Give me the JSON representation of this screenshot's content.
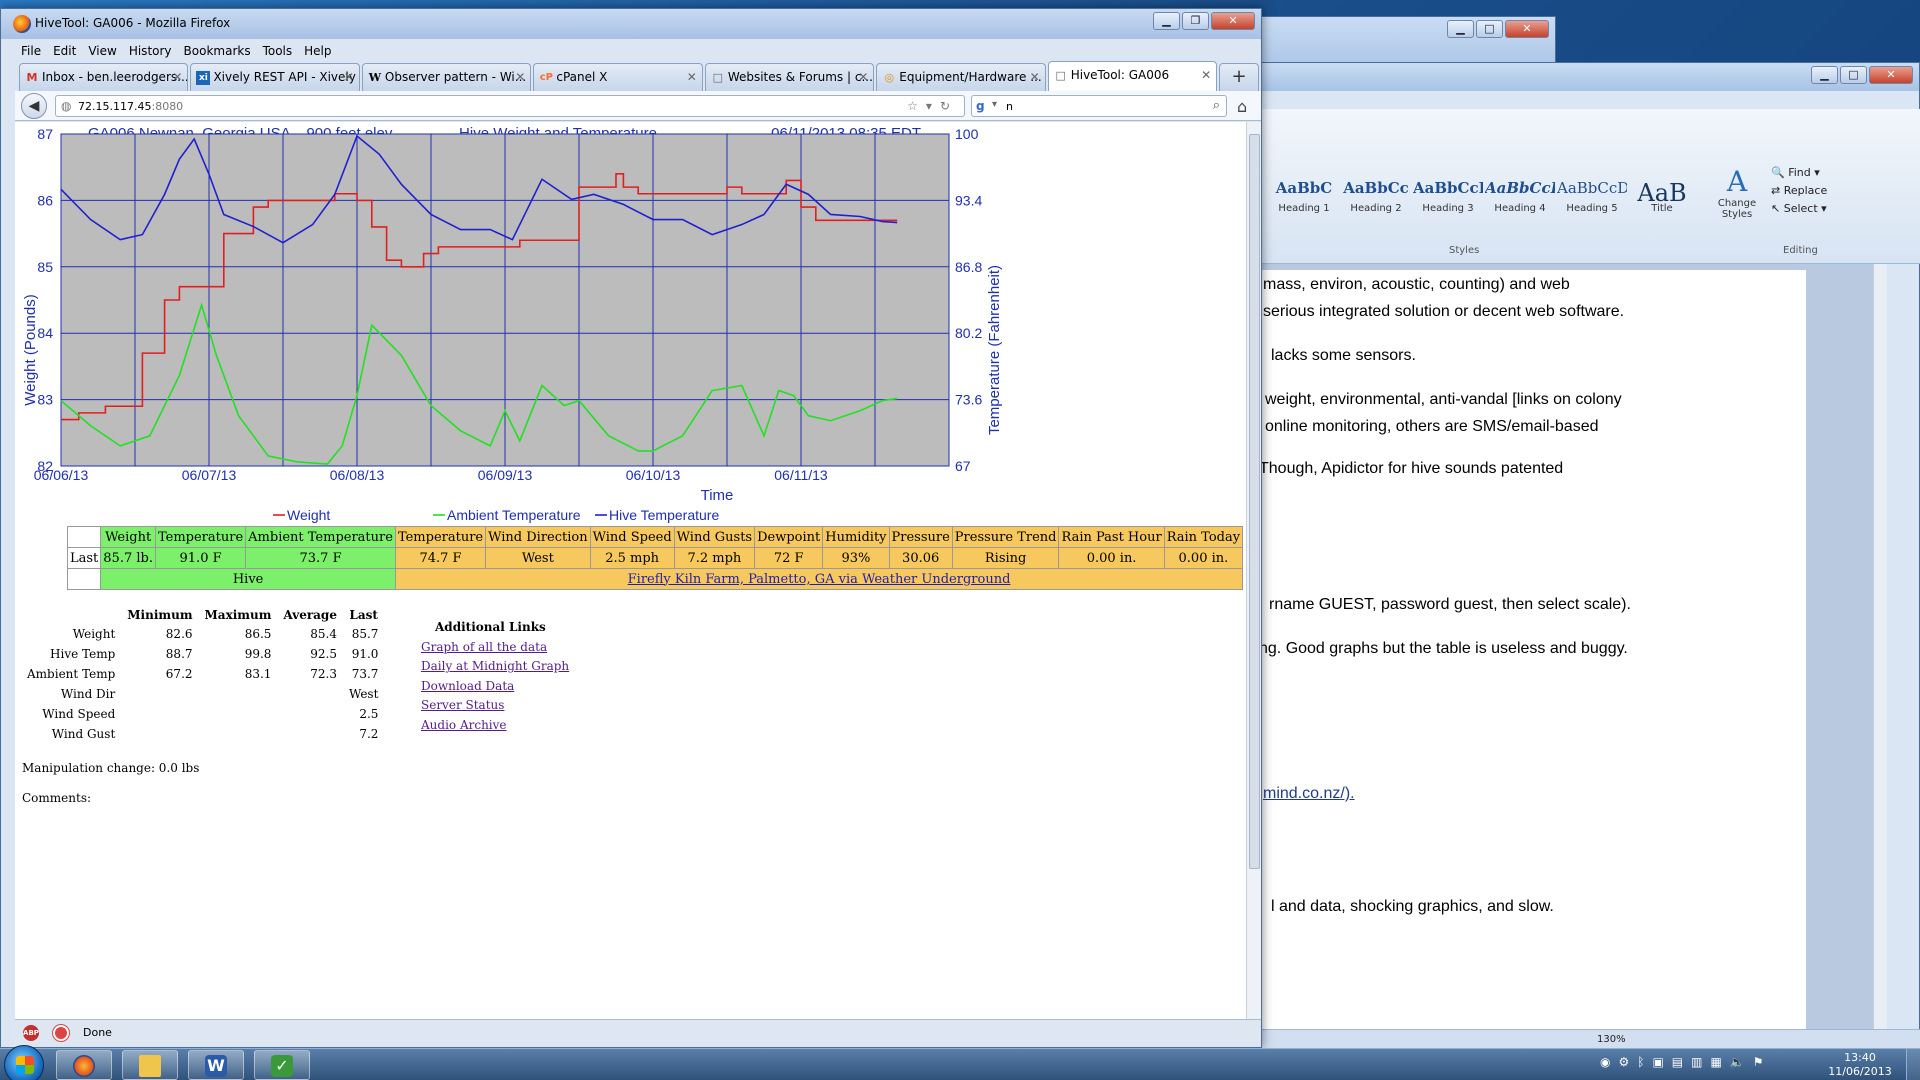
{
  "firefox": {
    "title": "HiveTool: GA006 - Mozilla Firefox",
    "menu": [
      "File",
      "Edit",
      "View",
      "History",
      "Bookmarks",
      "Tools",
      "Help"
    ],
    "tabs": [
      {
        "icon": "gmail-icon",
        "glyph": "M",
        "color": "#d93025",
        "label": "Inbox - ben.leerodgers..."
      },
      {
        "icon": "xively-icon",
        "glyph": "xi",
        "color": "#1a66b8",
        "label": "Xively REST API - Xively"
      },
      {
        "icon": "wikipedia-icon",
        "glyph": "W",
        "color": "#222222",
        "label": "Observer pattern - Wi..."
      },
      {
        "icon": "cpanel-icon",
        "glyph": "cP",
        "color": "#ff6c2c",
        "label": "cPanel X"
      },
      {
        "icon": "page-icon",
        "glyph": "□",
        "color": "#666666",
        "label": "Websites & Forums | c..."
      },
      {
        "icon": "forum-icon",
        "glyph": "◎",
        "color": "#e38a12",
        "label": "Equipment/Hardware ..."
      },
      {
        "icon": "page-icon",
        "glyph": "□",
        "color": "#666666",
        "label": "HiveTool: GA006"
      }
    ],
    "url_host": "72.15.117.45",
    "url_port": ":8080",
    "search_text": "n",
    "status": "Done"
  },
  "page": {
    "chart_header_left": "GA006 Newnan, Georgia USA – 900 feet elev.",
    "chart_header_center": "Hive Weight and Temperature",
    "chart_header_right": "06/11/2013 08:35 EDT"
  },
  "chart_data": {
    "type": "line",
    "title": "Hive Weight and Temperature",
    "xlabel": "Time",
    "ylabel": "Weight (Pounds)",
    "y2label": "Temperature (Fahrenheit)",
    "ylim": [
      82,
      87
    ],
    "y2lim": [
      67,
      100
    ],
    "xlim": [
      "06/06/13 00:00",
      "06/12/13 00:00"
    ],
    "x_tick_labels": [
      "06/06/13",
      "06/07/13",
      "06/08/13",
      "06/09/13",
      "06/10/13",
      "06/11/13"
    ],
    "y_tick_labels": [
      "82",
      "83",
      "84",
      "85",
      "86",
      "87"
    ],
    "y2_tick_labels": [
      "67",
      "73.6",
      "80.2",
      "86.8",
      "93.4",
      "100"
    ],
    "grid": true,
    "legend_position": "bottom",
    "series": [
      {
        "name": "Weight",
        "axis": "left",
        "color": "#e02020",
        "x": [
          0.0,
          0.12,
          0.2,
          0.3,
          0.5,
          0.55,
          0.7,
          0.8,
          0.9,
          1.1,
          1.3,
          1.4,
          1.55,
          1.7,
          1.85,
          2.0,
          2.1,
          2.2,
          2.3,
          2.45,
          2.55,
          2.7,
          2.9,
          3.1,
          3.3,
          3.5,
          3.65,
          3.75,
          3.8,
          3.9,
          4.0,
          4.2,
          4.5,
          4.6,
          4.8,
          4.9,
          5.0,
          5.1,
          5.2,
          5.3,
          5.45,
          5.55,
          5.65
        ],
        "y": [
          82.7,
          82.8,
          82.8,
          82.9,
          82.9,
          83.7,
          84.5,
          84.7,
          84.7,
          85.5,
          85.9,
          86.0,
          86.0,
          86.0,
          86.1,
          86.0,
          85.6,
          85.1,
          85.0,
          85.2,
          85.3,
          85.3,
          85.3,
          85.4,
          85.4,
          86.2,
          86.2,
          86.4,
          86.2,
          86.1,
          86.1,
          86.1,
          86.2,
          86.1,
          86.1,
          86.3,
          85.9,
          85.7,
          85.7,
          85.7,
          85.7,
          85.7,
          85.7
        ]
      },
      {
        "name": "Ambient Temperature",
        "axis": "right",
        "color": "#22e022",
        "x": [
          0.0,
          0.2,
          0.4,
          0.6,
          0.8,
          0.95,
          1.05,
          1.2,
          1.4,
          1.6,
          1.8,
          1.9,
          2.0,
          2.1,
          2.3,
          2.5,
          2.7,
          2.9,
          3.0,
          3.1,
          3.25,
          3.4,
          3.5,
          3.7,
          3.9,
          4.0,
          4.2,
          4.4,
          4.6,
          4.75,
          4.85,
          4.95,
          5.05,
          5.2,
          5.4,
          5.55,
          5.65
        ],
        "y": [
          73.5,
          71,
          69,
          70,
          76,
          83,
          78,
          72,
          68,
          67.4,
          67.2,
          69,
          74,
          81,
          78,
          73,
          70.5,
          69,
          72.5,
          69.5,
          75,
          73,
          73.5,
          70,
          68.5,
          68.5,
          70,
          74.5,
          75,
          70,
          74.5,
          74,
          72,
          71.5,
          72.5,
          73.5,
          73.7
        ]
      },
      {
        "name": "Hive Temperature",
        "axis": "right",
        "color": "#2020d0",
        "x": [
          0.0,
          0.2,
          0.4,
          0.55,
          0.7,
          0.8,
          0.9,
          1.0,
          1.1,
          1.3,
          1.5,
          1.7,
          1.85,
          2.0,
          2.15,
          2.3,
          2.5,
          2.7,
          2.9,
          3.05,
          3.25,
          3.45,
          3.6,
          3.8,
          4.0,
          4.2,
          4.4,
          4.6,
          4.75,
          4.9,
          5.05,
          5.2,
          5.4,
          5.55,
          5.65
        ],
        "y": [
          94.5,
          91.5,
          89.5,
          90,
          94,
          97.5,
          99.5,
          96,
          92,
          90.8,
          89.2,
          91,
          94,
          99.8,
          98,
          95,
          92,
          90.5,
          90.5,
          89.5,
          95.5,
          93.5,
          94,
          93,
          91.5,
          91.5,
          90,
          91,
          92,
          95,
          94,
          92,
          91.8,
          91.3,
          91.2
        ]
      }
    ],
    "legend": [
      "Weight",
      "Ambient Temperature",
      "Hive Temperature"
    ]
  },
  "table": {
    "headers_hive": [
      "Weight",
      "Temperature",
      "Ambient Temperature"
    ],
    "headers_wx": [
      "Temperature",
      "Wind Direction",
      "Wind Speed",
      "Wind Gusts",
      "Dewpoint",
      "Humidity",
      "Pressure",
      "Pressure Trend",
      "Rain Past Hour",
      "Rain Today"
    ],
    "row_label": "Last",
    "values_hive": [
      "85.7 lb.",
      "91.0 F",
      "73.7 F"
    ],
    "values_wx": [
      "74.7 F",
      "West",
      "2.5 mph",
      "7.2 mph",
      "72 F",
      "93%",
      "30.06",
      "Rising",
      "0.00 in.",
      "0.00 in."
    ],
    "footer_hive": "Hive",
    "footer_wx_link": "Firefly Kiln Farm, Palmetto, GA via Weather Underground"
  },
  "stats": {
    "columns": [
      "Minimum",
      "Maximum",
      "Average",
      "Last"
    ],
    "rows": [
      {
        "label": "Weight",
        "min": "82.6",
        "max": "86.5",
        "avg": "85.4",
        "last": "85.7"
      },
      {
        "label": "Hive Temp",
        "min": "88.7",
        "max": "99.8",
        "avg": "92.5",
        "last": "91.0"
      },
      {
        "label": "Ambient Temp",
        "min": "67.2",
        "max": "83.1",
        "avg": "72.3",
        "last": "73.7"
      },
      {
        "label": "Wind Dir",
        "min": "",
        "max": "",
        "avg": "",
        "last": "West"
      },
      {
        "label": "Wind Speed",
        "min": "",
        "max": "",
        "avg": "",
        "last": "2.5"
      },
      {
        "label": "Wind Gust",
        "min": "",
        "max": "",
        "avg": "",
        "last": "7.2"
      }
    ]
  },
  "links": {
    "heading": "Additional Links",
    "items": [
      "Graph of all the data",
      "Daily at Midnight Graph",
      "Download Data",
      "Server Status",
      "Audio Archive"
    ]
  },
  "manipulation": "Manipulation change: 0.0 lbs",
  "comments": "Comments:",
  "word": {
    "styles": [
      {
        "sample": "AaBbC",
        "name": "Heading 1"
      },
      {
        "sample": "AaBbCc",
        "name": "Heading 2"
      },
      {
        "sample": "AaBbCcI",
        "name": "Heading 3"
      },
      {
        "sample": "AaBbCcD",
        "name": "Heading 4"
      },
      {
        "sample": "AaBbCcD",
        "name": "Heading 5"
      },
      {
        "sample": "AaB",
        "name": "Title"
      }
    ],
    "change_styles": "Change Styles",
    "find": "Find ▾",
    "replace": "Replace",
    "select": "Select ▾",
    "group_styles": "Styles",
    "group_editing": "Editing",
    "lines": [
      "mass, environ, acoustic, counting) and web",
      "serious integrated solution or decent web software.",
      "lacks some sensors.",
      "weight, environmental, anti-vandal [links on colony",
      "online monitoring, others are SMS/email-based",
      "Though, Apidictor for hive sounds patented",
      "rname GUEST, password guest, then select scale).",
      "ng. Good graphs but the table is useless and buggy.",
      "mind.co.nz/).",
      "l and data, shocking graphics, and slow."
    ],
    "zoom": "130%"
  },
  "taskbar": {
    "time": "13:40",
    "date": "11/06/2013"
  }
}
